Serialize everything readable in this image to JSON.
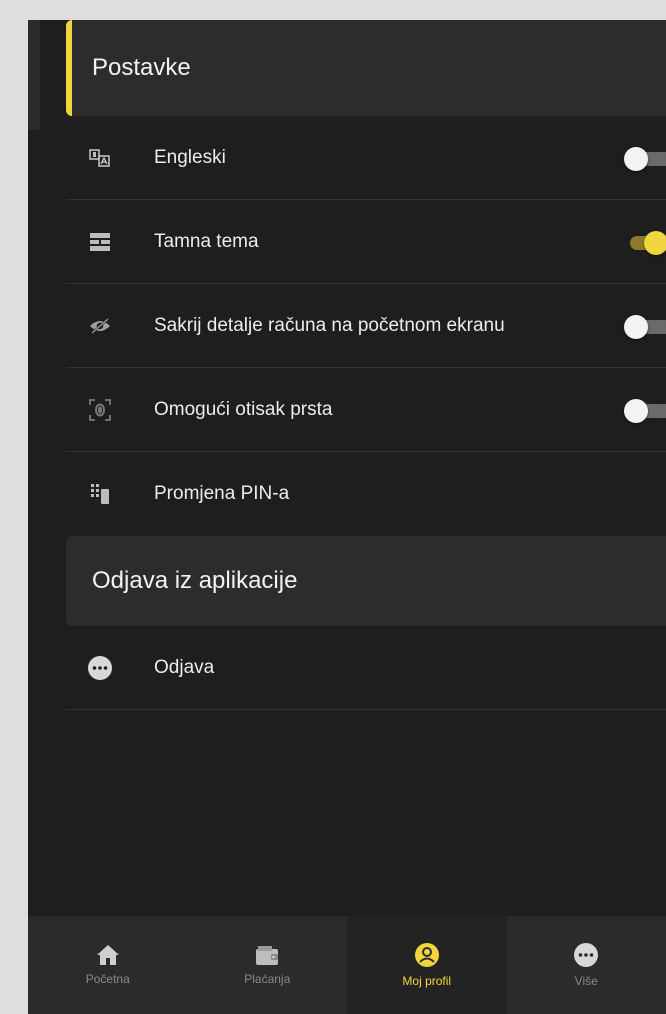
{
  "settings": {
    "header": "Postavke",
    "items": [
      {
        "label": "Engleski",
        "icon": "translate-icon",
        "toggle": "off"
      },
      {
        "label": "Tamna tema",
        "icon": "theme-icon",
        "toggle": "on"
      },
      {
        "label": "Sakrij detalje računa na početnom ekranu",
        "icon": "eye-off-icon",
        "toggle": "off"
      },
      {
        "label": "Omogući otisak prsta",
        "icon": "fingerprint-icon",
        "toggle": "off"
      },
      {
        "label": "Promjena PIN-a",
        "icon": "pin-keypad-icon",
        "toggle": null
      }
    ]
  },
  "logout": {
    "header": "Odjava iz aplikacije",
    "item_label": "Odjava",
    "icon": "more-circle-icon"
  },
  "bottom_nav": {
    "items": [
      {
        "label": "Početna",
        "icon": "home-icon",
        "active": false
      },
      {
        "label": "Plaćanja",
        "icon": "wallet-icon",
        "active": false
      },
      {
        "label": "Moj profil",
        "icon": "profile-icon",
        "active": true
      },
      {
        "label": "Više",
        "icon": "more-circle-icon",
        "active": false
      }
    ]
  },
  "colors": {
    "accent": "#f0d53c",
    "background": "#1e1e1e",
    "header_bg": "#2c2c2c"
  }
}
